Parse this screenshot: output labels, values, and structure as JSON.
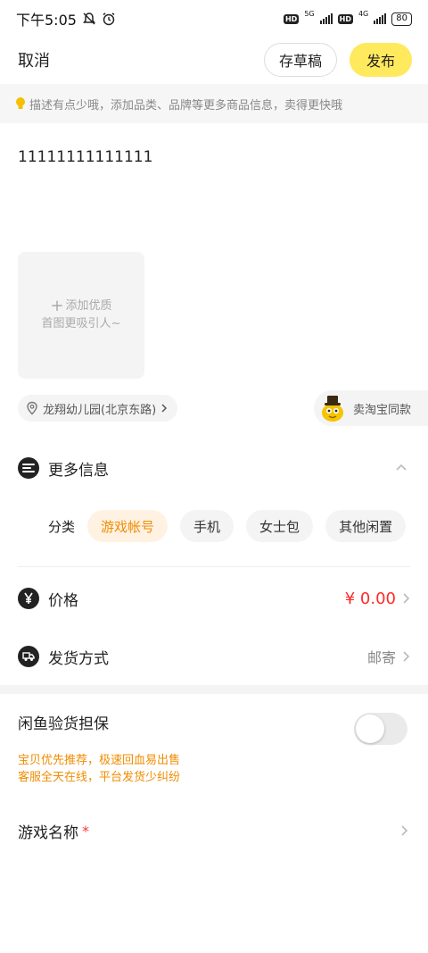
{
  "status_bar": {
    "time": "下午5:05",
    "network_1": "5G",
    "network_2": "4G",
    "battery": "80"
  },
  "header": {
    "cancel_label": "取消",
    "draft_label": "存草稿",
    "publish_label": "发布",
    "publish_color": "#ffe95c"
  },
  "tip": {
    "text": "描述有点少哦，添加品类、品牌等更多商品信息，卖得更快哦"
  },
  "description": {
    "value": "11111111111111"
  },
  "photo": {
    "line1": "添加优质",
    "line2": "首图更吸引人~"
  },
  "location": {
    "text": "龙翔幼儿园(北京东路)"
  },
  "sell_same": {
    "label": "卖淘宝同款"
  },
  "more_info": {
    "label": "更多信息"
  },
  "category": {
    "label": "分类",
    "options": [
      "游戏帐号",
      "手机",
      "女士包",
      "其他闲置"
    ],
    "selected": "游戏帐号",
    "accent_color": "#f08c00"
  },
  "price": {
    "label": "价格",
    "value": "¥ 0.00",
    "color": "#ff2a2a"
  },
  "shipping": {
    "label": "发货方式",
    "value": "邮寄"
  },
  "guarantee": {
    "label": "闲鱼验货担保",
    "enabled": false,
    "promo_line1": "宝贝优先推荐，极速回血易出售",
    "promo_line2": "客服全天在线，平台发货少纠纷"
  },
  "game_name": {
    "label": "游戏名称",
    "required_mark": "*"
  }
}
